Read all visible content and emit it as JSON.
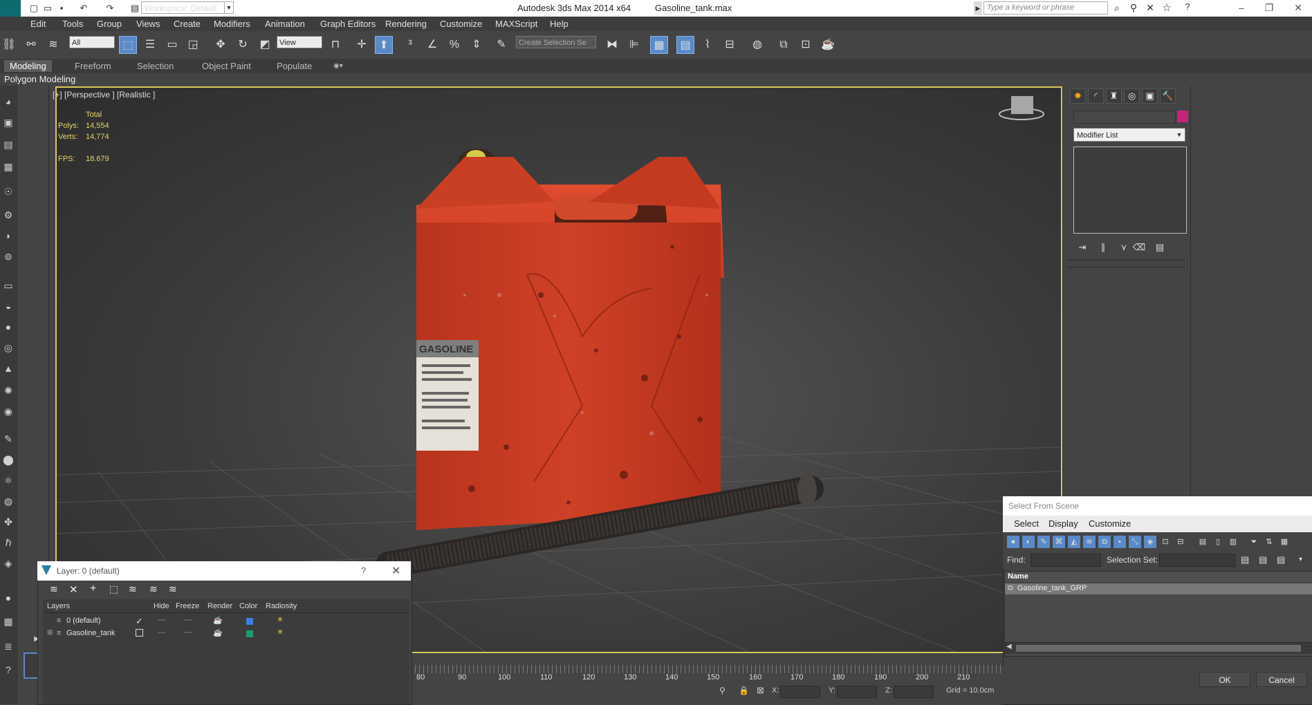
{
  "titlebar": {
    "workspace": "Workspace: Default",
    "app": "Autodesk 3ds Max  2014 x64",
    "file": "Gasoline_tank.max",
    "search_placeholder": "Type a keyword or phrase"
  },
  "menu": [
    "Edit",
    "Tools",
    "Group",
    "Views",
    "Create",
    "Modifiers",
    "Animation",
    "Graph Editors",
    "Rendering",
    "Customize",
    "MAXScript",
    "Help"
  ],
  "toolbar": {
    "filter": "All",
    "refcoord": "View",
    "selset": "Create Selection Se"
  },
  "ribbon": {
    "tabs": [
      "Modeling",
      "Freeform",
      "Selection",
      "Object Paint",
      "Populate"
    ],
    "panel": "Polygon Modeling"
  },
  "viewport": {
    "label": "[+] [Perspective ] [Realistic ]",
    "stats": {
      "total_label": "Total",
      "polys_label": "Polys:",
      "polys": "14,554",
      "verts_label": "Verts:",
      "verts": "14,774",
      "fps_label": "FPS:",
      "fps": "18.679"
    },
    "object_text": "GASOLINE"
  },
  "cmdpanel": {
    "modifier_list": "Modifier List",
    "object_color": "#c8237a"
  },
  "layer_dialog": {
    "title": "Layer: 0 (default)",
    "help": "?",
    "columns": [
      "Layers",
      "Hide",
      "Freeze",
      "Render",
      "Color",
      "Radiosity"
    ],
    "rows": [
      {
        "name": "0 (default)",
        "color": "#3f7fe0"
      },
      {
        "name": "Gasoline_tank",
        "color": "#1f9a6a"
      }
    ]
  },
  "select_from_scene": {
    "title": "Select From Scene",
    "menu": [
      "Select",
      "Display",
      "Customize"
    ],
    "find_label": "Find:",
    "selection_set_label": "Selection Set:",
    "name_header": "Name",
    "items": [
      "Gasoline_tank_GRP"
    ],
    "ok": "OK",
    "cancel": "Cancel"
  },
  "timeline": {
    "ticks": [
      "80",
      "90",
      "100",
      "110",
      "120",
      "130",
      "140",
      "150",
      "160",
      "170",
      "180",
      "190",
      "200",
      "210"
    ]
  },
  "status": {
    "x_label": "X:",
    "y_label": "Y:",
    "z_label": "Z:",
    "grid": "Grid = 10.0cm"
  }
}
